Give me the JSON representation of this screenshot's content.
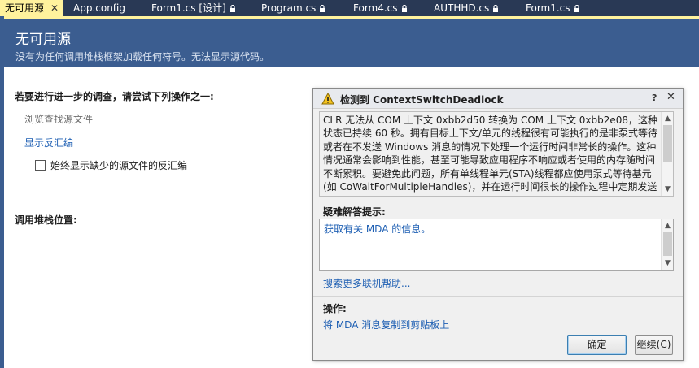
{
  "tabs": [
    {
      "label": "无可用源",
      "active": true,
      "closable": true,
      "locked": false
    },
    {
      "label": "App.config",
      "active": false,
      "closable": false,
      "locked": false
    },
    {
      "label": "Form1.cs [设计]",
      "active": false,
      "closable": false,
      "locked": true
    },
    {
      "label": "Program.cs",
      "active": false,
      "closable": false,
      "locked": true
    },
    {
      "label": "Form4.cs",
      "active": false,
      "closable": false,
      "locked": true
    },
    {
      "label": "AUTHHD.cs",
      "active": false,
      "closable": false,
      "locked": true
    },
    {
      "label": "Form1.cs",
      "active": false,
      "closable": false,
      "locked": true
    }
  ],
  "tab_close_glyph": "✕",
  "header": {
    "title": "无可用源",
    "subtitle": "没有为任何调用堆栈框架加载任何符号。无法显示源代码。"
  },
  "main": {
    "investigate_heading": "若要进行进一步的调查，请尝试下列操作之一:",
    "browse_source": "浏览查找源文件",
    "show_disassembly": "显示反汇编",
    "always_show_checkbox_label": "始终显示缺少的源文件的反汇编",
    "always_show_checked": false,
    "call_stack_heading": "调用堆栈位置:"
  },
  "dialog": {
    "title": "检测到 ContextSwitchDeadlock",
    "help_glyph": "?",
    "close_glyph": "✕",
    "message": "CLR 无法从 COM 上下文 0xbb2d50 转换为 COM 上下文 0xbb2e08，这种状态已持续 60 秒。拥有目标上下文/单元的线程很有可能执行的是非泵式等待或者在不发送 Windows 消息的情况下处理一个运行时间非常长的操作。这种情况通常会影响到性能，甚至可能导致应用程序不响应或者使用的内存随时间不断累积。要避免此问题，所有单线程单元(STA)线程都应使用泵式等待基元(如 CoWaitForMultipleHandles)，并在运行时间很长的操作过程中定期发送",
    "tips_label": "疑难解答提示:",
    "tips_link": "获取有关 MDA 的信息。",
    "search_link": "搜索更多联机帮助...",
    "ops_label": "操作:",
    "copy_link": "将 MDA 消息复制到剪贴板上",
    "ok_button": "确定",
    "continue_button": "继续",
    "continue_mnemonic": "C",
    "icons": {
      "warning": "warning-icon",
      "close": "close-icon",
      "help": "help-icon",
      "lock": "lock-icon"
    },
    "colors": {
      "accent": "#3b5d90",
      "active_tab": "#fff29d",
      "link": "#1e5fb3"
    }
  }
}
